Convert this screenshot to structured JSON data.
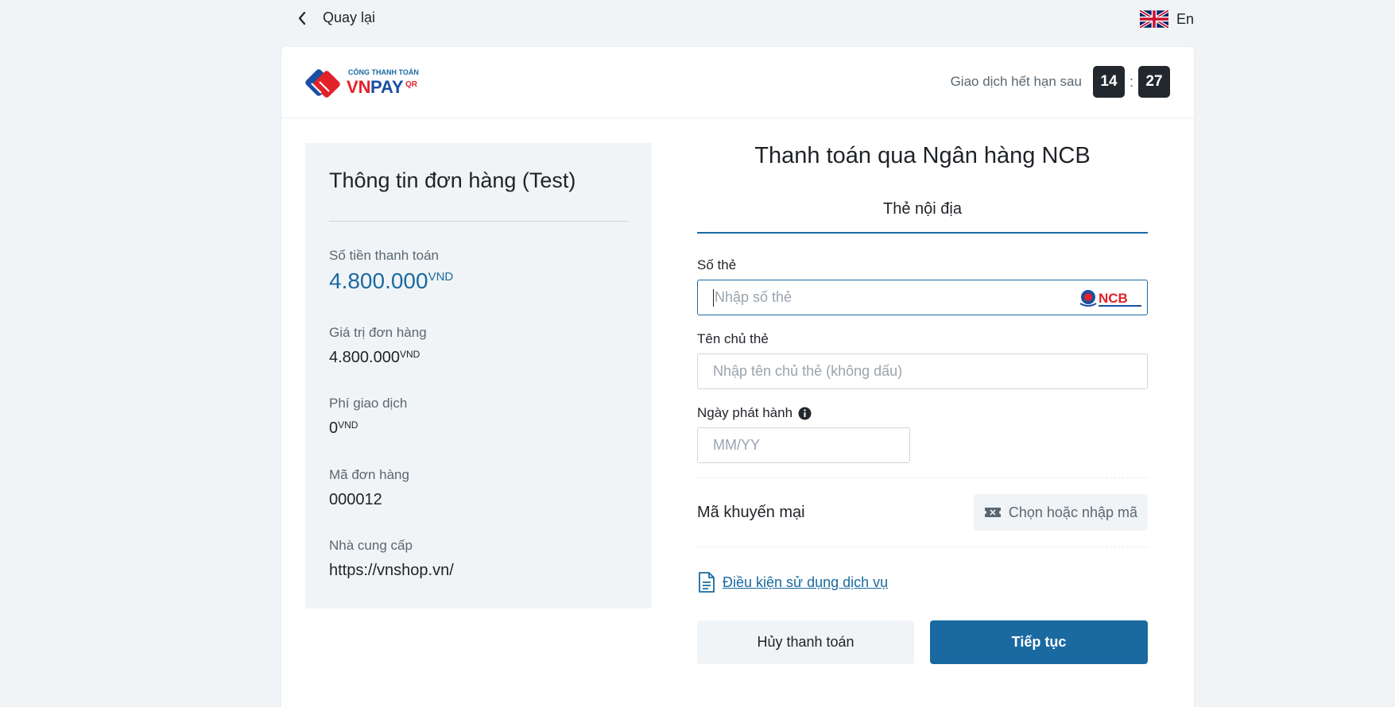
{
  "topbar": {
    "back_label": "Quay lại",
    "language_label": "En"
  },
  "header": {
    "logo_text": "CỔNG THANH TOÁN VNPAY QR",
    "timer_label": "Giao dịch hết hạn sau",
    "timer_minutes": "14",
    "timer_separator": ":",
    "timer_seconds": "27"
  },
  "order": {
    "title": "Thông tin đơn hàng (Test)",
    "amount_label": "Số tiền thanh toán",
    "amount_value": "4.800.000",
    "amount_currency": "VND",
    "order_value_label": "Giá trị đơn hàng",
    "order_value": "4.800.000",
    "order_value_currency": "VND",
    "fee_label": "Phí giao dịch",
    "fee_value": "0",
    "fee_currency": "VND",
    "order_id_label": "Mã đơn hàng",
    "order_id": "000012",
    "provider_label": "Nhà cung cấp",
    "provider": "https://vnshop.vn/"
  },
  "payment": {
    "title": "Thanh toán qua Ngân hàng NCB",
    "tab_label": "Thẻ nội địa",
    "card_number_label": "Số thẻ",
    "card_number_placeholder": "Nhập số thẻ",
    "bank_logo_text": "NCB",
    "card_holder_label": "Tên chủ thẻ",
    "card_holder_placeholder": "Nhập tên chủ thẻ (không dấu)",
    "issue_date_label": "Ngày phát hành",
    "issue_date_placeholder": "MM/YY",
    "promo_label": "Mã khuyến mại",
    "promo_button": "Chọn hoặc nhập mã",
    "terms_link": "Điều kiện sử dụng dịch vụ",
    "cancel_button": "Hủy thanh toán",
    "continue_button": "Tiếp tục"
  },
  "colors": {
    "accent": "#1a6aa1",
    "timer_bg": "#22282d",
    "panel_bg": "#f1f4f6"
  }
}
